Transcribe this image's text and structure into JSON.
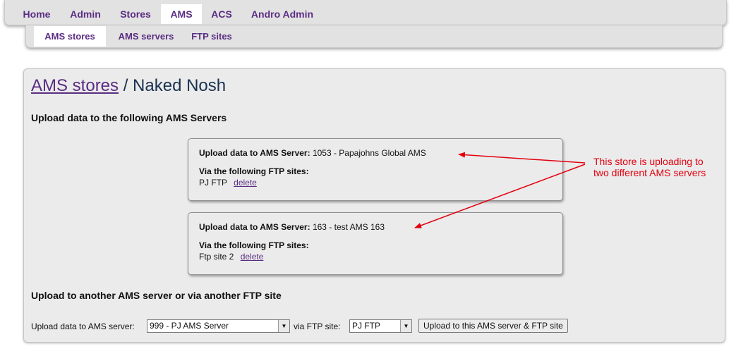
{
  "top_nav": {
    "items": [
      {
        "label": "Home"
      },
      {
        "label": "Admin"
      },
      {
        "label": "Stores"
      },
      {
        "label": "AMS",
        "active": true
      },
      {
        "label": "ACS"
      },
      {
        "label": "Andro Admin"
      }
    ]
  },
  "sub_nav": {
    "items": [
      {
        "label": "AMS stores",
        "active": true
      },
      {
        "label": "AMS servers"
      },
      {
        "label": "FTP sites"
      }
    ]
  },
  "page": {
    "breadcrumb_link": "AMS stores",
    "breadcrumb_separator": " / ",
    "store_name": "Naked Nosh",
    "upload_heading": "Upload data to the following AMS Servers",
    "server_label": "Upload data to AMS Server:",
    "ftp_label": "Via the following FTP sites:",
    "delete_label": "delete",
    "servers": [
      {
        "server": "1053 - Papajohns Global AMS",
        "ftp_site": "PJ FTP"
      },
      {
        "server": "163 - test AMS 163",
        "ftp_site": "Ftp site 2"
      }
    ],
    "another_heading": "Upload to another AMS server or via another FTP site"
  },
  "form": {
    "server_label": "Upload data to AMS server:",
    "server_selected": "999 - PJ AMS Server",
    "ftp_label": "via FTP site:",
    "ftp_selected": "PJ FTP",
    "submit_label": "Upload to this AMS server & FTP site"
  },
  "annotation": {
    "text": "This store is uploading to two different AMS servers",
    "color": "#e3000f"
  },
  "colors": {
    "nav_text": "#5a2d82",
    "panel_background": "#ebebeb",
    "title_text": "#1a3150"
  }
}
